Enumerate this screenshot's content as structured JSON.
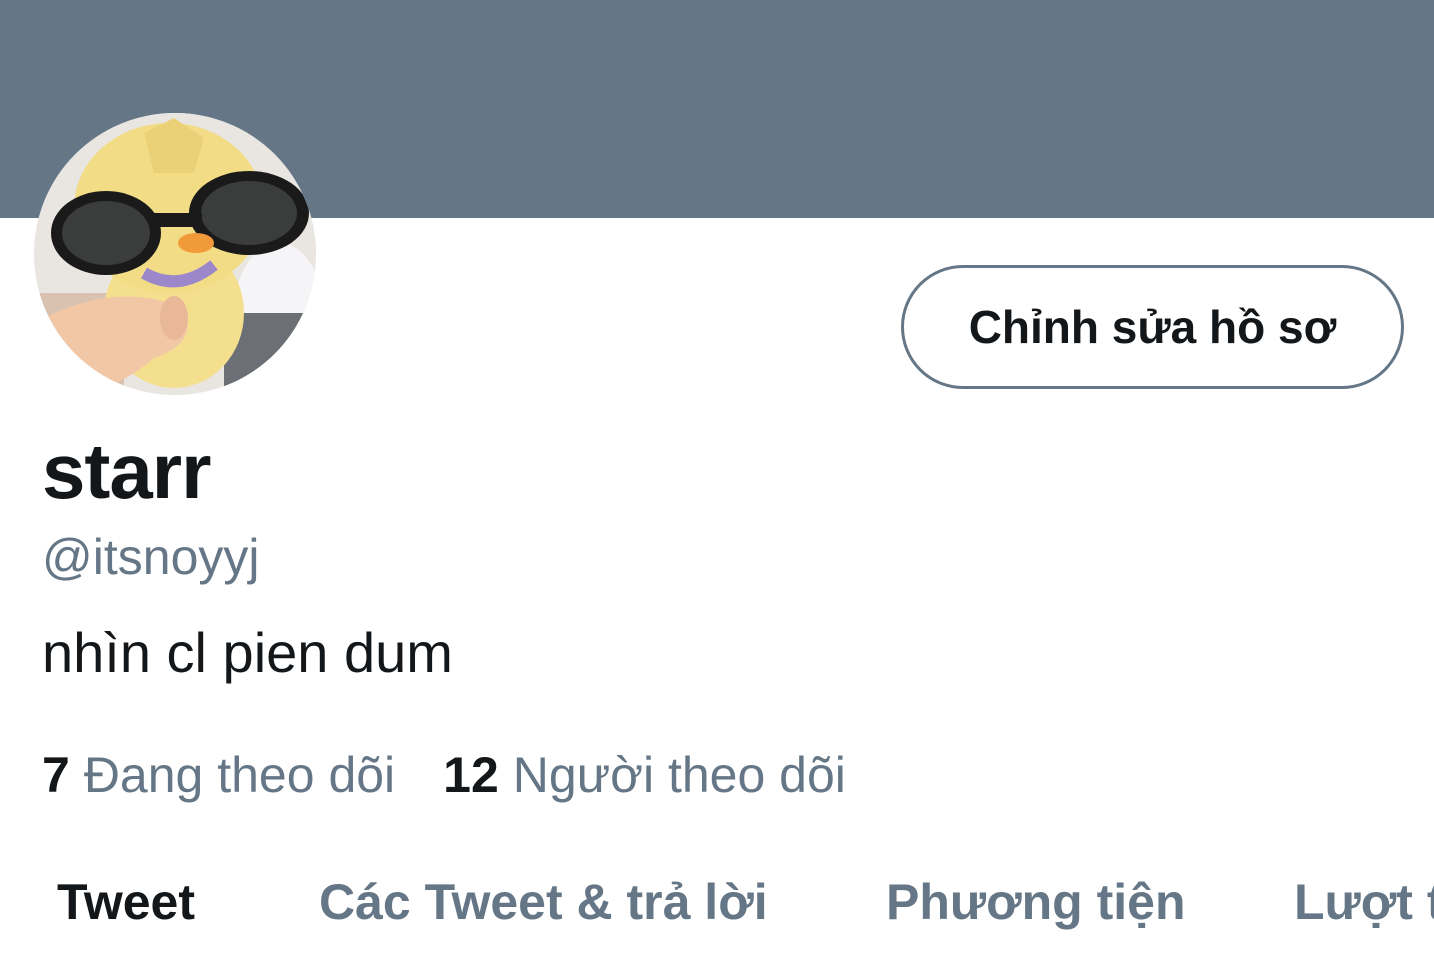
{
  "banner": {
    "color": "#657786"
  },
  "avatar": {
    "description": "avatar-photo"
  },
  "header": {
    "edit_profile_label": "Chỉnh sửa hồ sơ"
  },
  "profile": {
    "display_name": "starr",
    "handle": "@itsnoyyj",
    "bio": "nhìn cl pien dum"
  },
  "stats": {
    "following_count": "7",
    "following_label": "Đang theo dõi",
    "followers_count": "12",
    "followers_label": "Người theo dõi"
  },
  "tabs": [
    {
      "label": "Tweet",
      "active": true
    },
    {
      "label": "Các Tweet & trả lời",
      "active": false
    },
    {
      "label": "Phương tiện",
      "active": false
    },
    {
      "label": "Lượt t",
      "active": false
    }
  ],
  "colors": {
    "primary_text": "#14171a",
    "secondary_text": "#657786",
    "border": "#657786"
  }
}
